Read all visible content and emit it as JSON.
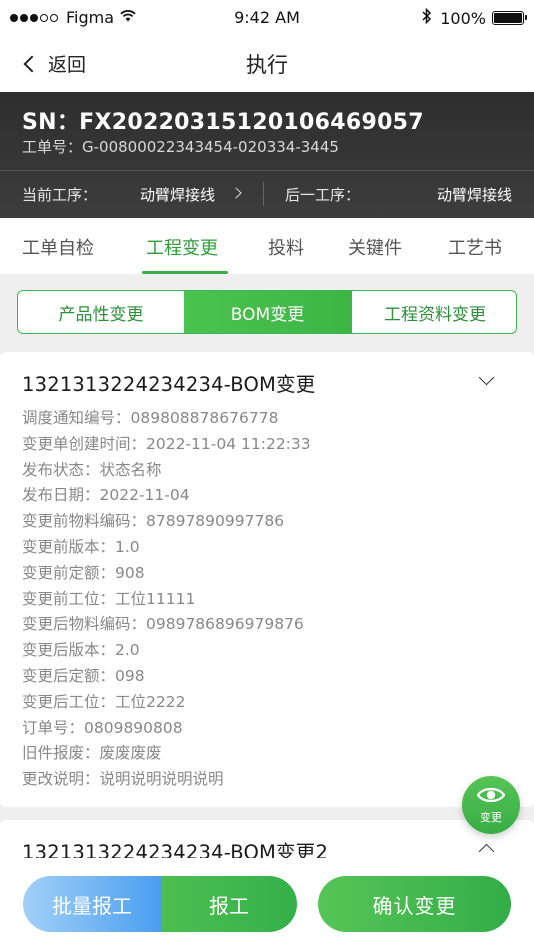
{
  "status_bar": {
    "carrier": "Figma",
    "time": "9:42 AM",
    "battery": "100%"
  },
  "nav": {
    "back_label": "返回",
    "title": "执行"
  },
  "header": {
    "sn": "SN：FX20220315120106469057",
    "work_order": "工单号：G-00800022343454-020334-3445",
    "current_process_label": "当前工序：",
    "current_process_value": "动臂焊接线",
    "next_process_label": "后一工序：",
    "next_process_value": "动臂焊接线"
  },
  "tabs": [
    {
      "label": "工单自检",
      "active": false
    },
    {
      "label": "工程变更",
      "active": true
    },
    {
      "label": "投料",
      "active": false
    },
    {
      "label": "关键件",
      "active": false
    },
    {
      "label": "工艺书",
      "active": false
    }
  ],
  "segments": [
    {
      "label": "产品性变更",
      "active": false
    },
    {
      "label": "BOM变更",
      "active": true
    },
    {
      "label": "工程资料变更",
      "active": false
    }
  ],
  "cards": [
    {
      "title": "1321313224234234-BOM变更",
      "expanded": true,
      "fields": [
        "调度通知编号：089808878676778",
        "变更单创建时间：2022-11-04 11:22:33",
        "发布状态：状态名称",
        "发布日期：2022-11-04",
        "变更前物料编码：87897890997786",
        "变更前版本：1.0",
        "变更前定额：908",
        "变更前工位：工位11111",
        "变更后物料编码：0989786896979876",
        "变更后版本：2.0",
        "变更后定额：098",
        "变更后工位：工位2222",
        "订单号：0809890808",
        "旧件报废：废废废废",
        "更改说明：说明说明说明说明"
      ]
    },
    {
      "title": "1321313224234234-BOM变更2",
      "expanded": false
    }
  ],
  "fab": {
    "label": "变更",
    "icon": "eye-icon"
  },
  "bottom": {
    "batch_report": "批量报工",
    "report": "报工",
    "confirm": "确认变更"
  },
  "colors": {
    "accent_green": "#3db545",
    "header_dark": "#333333",
    "batch_blue": "#4a9ef0"
  }
}
